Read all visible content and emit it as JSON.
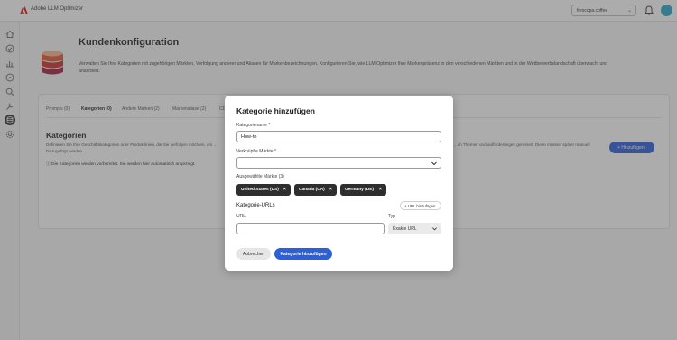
{
  "app": {
    "title": "Adobe LLM Optimizer",
    "logo_icon": "adobe-logo-icon",
    "brand_color": "#eb1000"
  },
  "header": {
    "site_selector_value": "frescopa.coffee",
    "notification_icon": "bell-icon"
  },
  "rail": {
    "icons": [
      "home-icon",
      "check-circle-icon",
      "bar-chart-icon",
      "compass-icon",
      "search-icon",
      "tools-icon",
      "database-icon",
      "settings-icon"
    ],
    "active_index": 6
  },
  "page": {
    "title": "Kundenkonfiguration",
    "description": "Verwalten Sie Ihre Kategorien mit zugehörigen Märkten, Verfolgung anderer und Aliasen für Markenbezeichnungen. Konfigurieren Sie, wie LLM Optimizer Ihre Markenpräsenz in den verschiedenen Märkten und in der Wettbewerbslandschaft überwacht und analysiert."
  },
  "tabs": [
    {
      "label": "Prompts (0)"
    },
    {
      "label": "Kategorien (0)"
    },
    {
      "label": "Andere Marken (2)"
    },
    {
      "label": "Markenaliase (2)"
    },
    {
      "label": "CD"
    }
  ],
  "categories_section": {
    "heading": "Kategorien",
    "description_left": "Definieren Sie Ihre Geschäftskategorien oder Produktlinien, die Sie verfolgen möchten, um ... hinzugefügt werden",
    "description_right": "...ch Themen und aufforderungen generiert. Diese müssen später manuell",
    "info": "Die Kategorien werden vorbereitet. Sie werden hier automatisch angezeigt.",
    "add_button": "Hinzufügen"
  },
  "modal": {
    "title": "Kategorie hinzufügen",
    "name_label": "Kategoriename",
    "name_value": "How-to",
    "markets_label": "Verknüpfte Märkte",
    "markets_value": "",
    "selected_label": "Ausgewählte Märkte (3)",
    "chips": [
      {
        "label": "United States (US)"
      },
      {
        "label": "Canada (CA)"
      },
      {
        "label": "Germany (DE)"
      }
    ],
    "urls_title": "Kategorie-URLs",
    "url_add_button": "URL hinzufügen",
    "url_label": "URL",
    "url_value": "",
    "type_label": "Typ",
    "type_value": "Exakte URL",
    "cancel_button": "Abbrechen",
    "submit_button": "Kategorie hinzufügen",
    "required_marker": "*",
    "chip_close": "×"
  },
  "colors": {
    "primary": "#2c5fd8",
    "chip_bg": "#2e2e2e",
    "avatar": "#2fa6c8"
  }
}
